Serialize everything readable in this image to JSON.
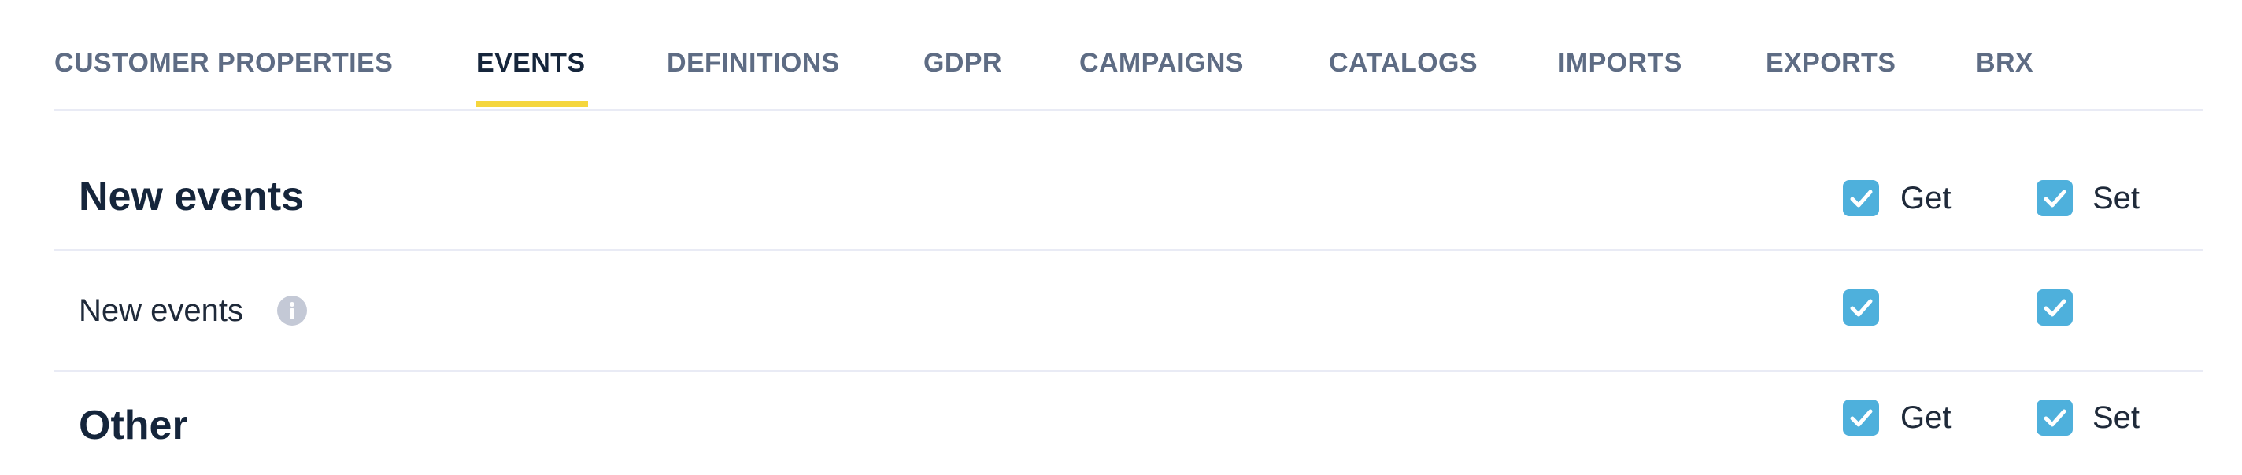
{
  "tabs": [
    {
      "label": "CUSTOMER PROPERTIES",
      "active": false
    },
    {
      "label": "EVENTS",
      "active": true
    },
    {
      "label": "DEFINITIONS",
      "active": false
    },
    {
      "label": "GDPR",
      "active": false
    },
    {
      "label": "CAMPAIGNS",
      "active": false
    },
    {
      "label": "CATALOGS",
      "active": false
    },
    {
      "label": "IMPORTS",
      "active": false
    },
    {
      "label": "EXPORTS",
      "active": false
    },
    {
      "label": "BRX",
      "active": false
    }
  ],
  "colors": {
    "active_tab_underline": "#f5d63d",
    "checkbox": "#4eb0dc",
    "title": "#15253b",
    "tab_inactive": "#5e6c84"
  },
  "sections": {
    "new_events": {
      "title": "New events",
      "get_label": "Get",
      "set_label": "Set",
      "get_checked": true,
      "set_checked": true,
      "rows": [
        {
          "label": "New events",
          "info_icon": "info-icon",
          "get_checked": true,
          "set_checked": true
        }
      ]
    },
    "other": {
      "title": "Other",
      "get_label": "Get",
      "set_label": "Set",
      "get_checked": true,
      "set_checked": true
    }
  }
}
